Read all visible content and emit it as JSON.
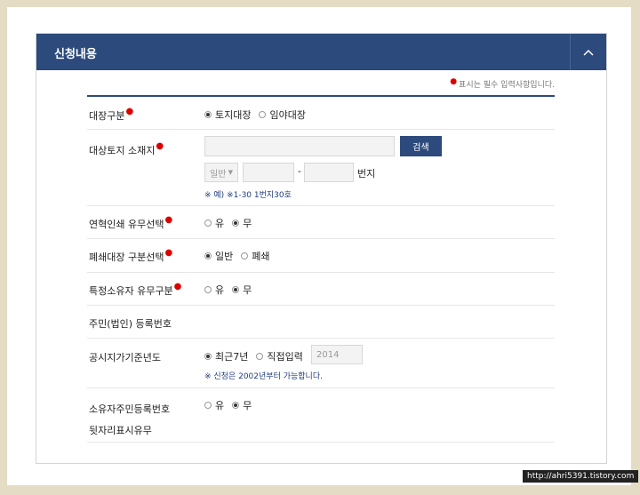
{
  "header": {
    "title": "신청내용",
    "toggle_icon": "chevron-up-icon"
  },
  "required_note": "표시는 필수 입력사항입니다.",
  "fields": {
    "ledger_type": {
      "label": "대장구분",
      "options": [
        "토지대장",
        "임야대장"
      ],
      "selected": "토지대장"
    },
    "land_location": {
      "label": "대상토지 소재지",
      "search_label": "검색",
      "lot_type_value": "일반",
      "lot_separator": "-",
      "lot_suffix": "번지",
      "hint": "※ 예) ※1-30 1번지30호"
    },
    "history_print": {
      "label": "연혁인쇄 유무선택",
      "options": [
        "유",
        "무"
      ],
      "selected": "무"
    },
    "closed_ledger": {
      "label": "폐쇄대장 구분선택",
      "options": [
        "일반",
        "폐쇄"
      ],
      "selected": "일반"
    },
    "special_owner": {
      "label": "특정소유자 유무구분",
      "options": [
        "유",
        "무"
      ],
      "selected": "무"
    },
    "resident_number": {
      "label": "주민(법인) 등록번호"
    },
    "base_year": {
      "label": "공시지가기준년도",
      "options": [
        "최근7년",
        "직접입력"
      ],
      "selected": "최근7년",
      "year_placeholder": "2014",
      "hint": "※ 신청은 2002년부터 가능합니다."
    },
    "owner_suffix": {
      "label_line1": "소유자주민등록번호",
      "label_line2": "뒷자리표시유무",
      "options": [
        "유",
        "무"
      ],
      "selected": "무"
    }
  },
  "watermark": "http://ahri5391.tistory.com"
}
